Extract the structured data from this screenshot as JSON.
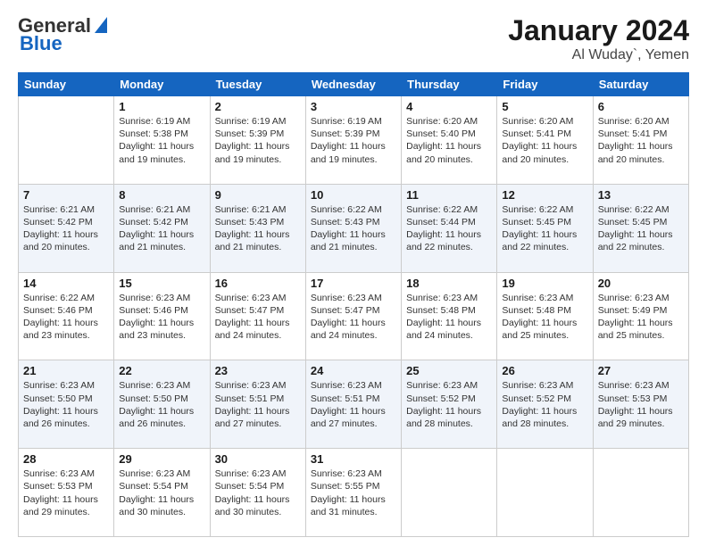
{
  "header": {
    "logo_line1": "General",
    "logo_line2": "Blue",
    "title": "January 2024",
    "location": "Al Wuday`, Yemen"
  },
  "days_of_week": [
    "Sunday",
    "Monday",
    "Tuesday",
    "Wednesday",
    "Thursday",
    "Friday",
    "Saturday"
  ],
  "weeks": [
    [
      {
        "day": "",
        "info": ""
      },
      {
        "day": "1",
        "info": "Sunrise: 6:19 AM\nSunset: 5:38 PM\nDaylight: 11 hours\nand 19 minutes."
      },
      {
        "day": "2",
        "info": "Sunrise: 6:19 AM\nSunset: 5:39 PM\nDaylight: 11 hours\nand 19 minutes."
      },
      {
        "day": "3",
        "info": "Sunrise: 6:19 AM\nSunset: 5:39 PM\nDaylight: 11 hours\nand 19 minutes."
      },
      {
        "day": "4",
        "info": "Sunrise: 6:20 AM\nSunset: 5:40 PM\nDaylight: 11 hours\nand 20 minutes."
      },
      {
        "day": "5",
        "info": "Sunrise: 6:20 AM\nSunset: 5:41 PM\nDaylight: 11 hours\nand 20 minutes."
      },
      {
        "day": "6",
        "info": "Sunrise: 6:20 AM\nSunset: 5:41 PM\nDaylight: 11 hours\nand 20 minutes."
      }
    ],
    [
      {
        "day": "7",
        "info": "Sunrise: 6:21 AM\nSunset: 5:42 PM\nDaylight: 11 hours\nand 20 minutes."
      },
      {
        "day": "8",
        "info": "Sunrise: 6:21 AM\nSunset: 5:42 PM\nDaylight: 11 hours\nand 21 minutes."
      },
      {
        "day": "9",
        "info": "Sunrise: 6:21 AM\nSunset: 5:43 PM\nDaylight: 11 hours\nand 21 minutes."
      },
      {
        "day": "10",
        "info": "Sunrise: 6:22 AM\nSunset: 5:43 PM\nDaylight: 11 hours\nand 21 minutes."
      },
      {
        "day": "11",
        "info": "Sunrise: 6:22 AM\nSunset: 5:44 PM\nDaylight: 11 hours\nand 22 minutes."
      },
      {
        "day": "12",
        "info": "Sunrise: 6:22 AM\nSunset: 5:45 PM\nDaylight: 11 hours\nand 22 minutes."
      },
      {
        "day": "13",
        "info": "Sunrise: 6:22 AM\nSunset: 5:45 PM\nDaylight: 11 hours\nand 22 minutes."
      }
    ],
    [
      {
        "day": "14",
        "info": "Sunrise: 6:22 AM\nSunset: 5:46 PM\nDaylight: 11 hours\nand 23 minutes."
      },
      {
        "day": "15",
        "info": "Sunrise: 6:23 AM\nSunset: 5:46 PM\nDaylight: 11 hours\nand 23 minutes."
      },
      {
        "day": "16",
        "info": "Sunrise: 6:23 AM\nSunset: 5:47 PM\nDaylight: 11 hours\nand 24 minutes."
      },
      {
        "day": "17",
        "info": "Sunrise: 6:23 AM\nSunset: 5:47 PM\nDaylight: 11 hours\nand 24 minutes."
      },
      {
        "day": "18",
        "info": "Sunrise: 6:23 AM\nSunset: 5:48 PM\nDaylight: 11 hours\nand 24 minutes."
      },
      {
        "day": "19",
        "info": "Sunrise: 6:23 AM\nSunset: 5:48 PM\nDaylight: 11 hours\nand 25 minutes."
      },
      {
        "day": "20",
        "info": "Sunrise: 6:23 AM\nSunset: 5:49 PM\nDaylight: 11 hours\nand 25 minutes."
      }
    ],
    [
      {
        "day": "21",
        "info": "Sunrise: 6:23 AM\nSunset: 5:50 PM\nDaylight: 11 hours\nand 26 minutes."
      },
      {
        "day": "22",
        "info": "Sunrise: 6:23 AM\nSunset: 5:50 PM\nDaylight: 11 hours\nand 26 minutes."
      },
      {
        "day": "23",
        "info": "Sunrise: 6:23 AM\nSunset: 5:51 PM\nDaylight: 11 hours\nand 27 minutes."
      },
      {
        "day": "24",
        "info": "Sunrise: 6:23 AM\nSunset: 5:51 PM\nDaylight: 11 hours\nand 27 minutes."
      },
      {
        "day": "25",
        "info": "Sunrise: 6:23 AM\nSunset: 5:52 PM\nDaylight: 11 hours\nand 28 minutes."
      },
      {
        "day": "26",
        "info": "Sunrise: 6:23 AM\nSunset: 5:52 PM\nDaylight: 11 hours\nand 28 minutes."
      },
      {
        "day": "27",
        "info": "Sunrise: 6:23 AM\nSunset: 5:53 PM\nDaylight: 11 hours\nand 29 minutes."
      }
    ],
    [
      {
        "day": "28",
        "info": "Sunrise: 6:23 AM\nSunset: 5:53 PM\nDaylight: 11 hours\nand 29 minutes."
      },
      {
        "day": "29",
        "info": "Sunrise: 6:23 AM\nSunset: 5:54 PM\nDaylight: 11 hours\nand 30 minutes."
      },
      {
        "day": "30",
        "info": "Sunrise: 6:23 AM\nSunset: 5:54 PM\nDaylight: 11 hours\nand 30 minutes."
      },
      {
        "day": "31",
        "info": "Sunrise: 6:23 AM\nSunset: 5:55 PM\nDaylight: 11 hours\nand 31 minutes."
      },
      {
        "day": "",
        "info": ""
      },
      {
        "day": "",
        "info": ""
      },
      {
        "day": "",
        "info": ""
      }
    ]
  ]
}
